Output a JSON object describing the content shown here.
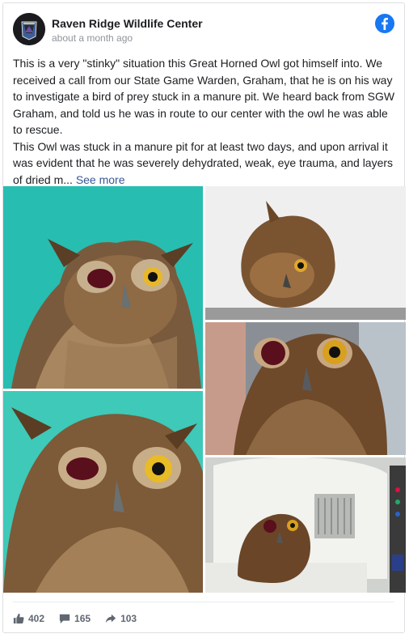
{
  "page": {
    "name": "Raven Ridge Wildlife Center",
    "timestamp": "about a month ago",
    "avatar_icon": "raven-ridge-logo-icon",
    "social_icon": "facebook-icon",
    "brand_color": "#1877f2"
  },
  "post": {
    "paragraph1": "This is a very \"stinky\" situation this Great Horned Owl got himself into. We received a call from our State Game Warden, Graham, that he is on his way to investigate a bird of prey stuck in a manure pit. We heard back from SGW Graham, and told us he was in route to our center with the owl he was able to rescue.",
    "paragraph2_prefix": "This Owl was stuck in a manure pit for at least two days, and upon arrival it was evident that he was severely dehydrated, weak, eye trauma, and layers of dried m...",
    "see_more": "See more",
    "link_color": "#365899"
  },
  "photos": [
    {
      "subject": "owl-teal-background-1"
    },
    {
      "subject": "owl-on-white-towel"
    },
    {
      "subject": "owl-closeup-clinic"
    },
    {
      "subject": "owl-teal-background-2"
    },
    {
      "subject": "owl-in-incubator"
    }
  ],
  "stats": {
    "likes": "402",
    "comments": "165",
    "shares": "103",
    "like_icon": "thumbs-up-icon",
    "comment_icon": "comment-icon",
    "share_icon": "share-arrow-icon"
  }
}
